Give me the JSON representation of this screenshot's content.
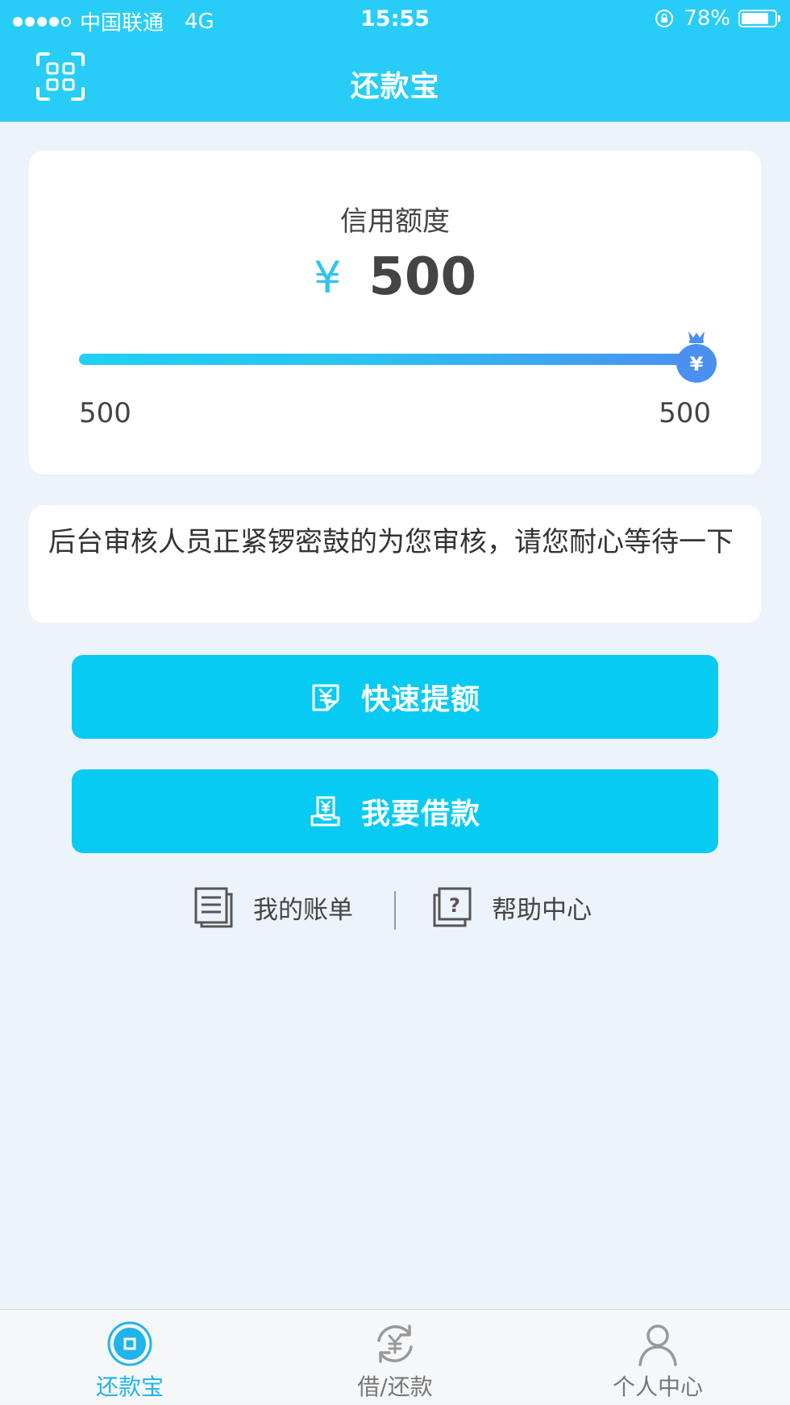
{
  "status_bar": {
    "carrier": "中国联通",
    "network": "4G",
    "time": "15:55",
    "battery": "78%"
  },
  "header": {
    "title": "还款宝",
    "scan_icon": "qr-scan-icon"
  },
  "credit": {
    "label": "信用额度",
    "currency": "¥",
    "amount": "500",
    "range_min": "500",
    "range_max": "500",
    "slider_fraction": 1.0
  },
  "notice": {
    "text": "后台审核人员正紧锣密鼓的为您审核，请您耐心等待一下"
  },
  "actions": {
    "quota_label": "快速提额",
    "borrow_label": "我要借款"
  },
  "links": {
    "bills_label": "我的账单",
    "help_label": "帮助中心"
  },
  "tabs": [
    {
      "label": "还款宝",
      "icon": "home-coin-icon",
      "active": true
    },
    {
      "label": "借/还款",
      "icon": "exchange-yen-icon",
      "active": false
    },
    {
      "label": "个人中心",
      "icon": "user-icon",
      "active": false
    }
  ],
  "colors": {
    "primary": "#27cdf7",
    "button": "#07cbf3",
    "active_tab": "#1fb5ea",
    "background": "#edf3fa"
  }
}
